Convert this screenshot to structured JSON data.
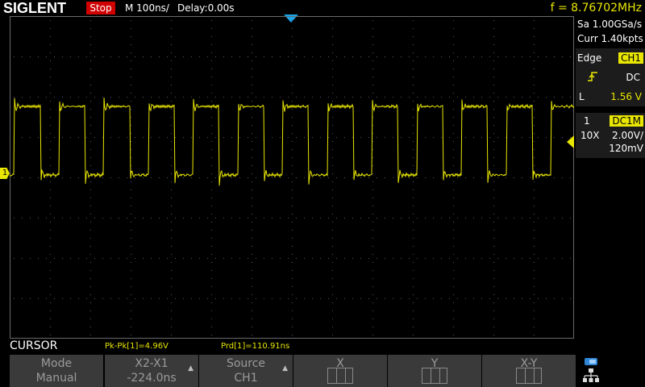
{
  "header": {
    "brand": "SIGLENT",
    "run_state": "Stop",
    "timebase": "M 100ns/",
    "delay": "Delay:0.00s",
    "frequency": "f = 8.76702MHz"
  },
  "acquisition": {
    "sample_rate": "Sa 1.00GSa/s",
    "memory": "Curr 1.40kpts"
  },
  "trigger": {
    "type": "Edge",
    "source": "CH1",
    "coupling": "DC",
    "level_label": "L",
    "level": "1.56 V"
  },
  "channel": {
    "number": "1",
    "coupling": "DC1M",
    "probe": "10X",
    "scale": "2.00V/",
    "offset": "120mV",
    "marker_label": "1"
  },
  "measurements": {
    "menu_title": "CURSOR",
    "pkpk": "Pk-Pk[1]=4.96V",
    "period": "Prd[1]=110.91ns"
  },
  "softkeys": [
    {
      "line1": "Mode",
      "line2": "Manual"
    },
    {
      "line1": "X2-X1",
      "line2": "-224.0ns"
    },
    {
      "line1": "Source",
      "line2": "CH1"
    },
    {
      "line1": "X",
      "line2": ""
    },
    {
      "line1": "Y",
      "line2": ""
    },
    {
      "line1": "X-Y",
      "line2": ""
    }
  ],
  "colors": {
    "trace": "#e9e600",
    "run_state_bg": "#d00000",
    "trigger_marker": "#1aa3e8",
    "frequency": "#e9e600"
  },
  "icons": {
    "trigger_edge": "rising-edge-icon",
    "network": "network-icon"
  }
}
